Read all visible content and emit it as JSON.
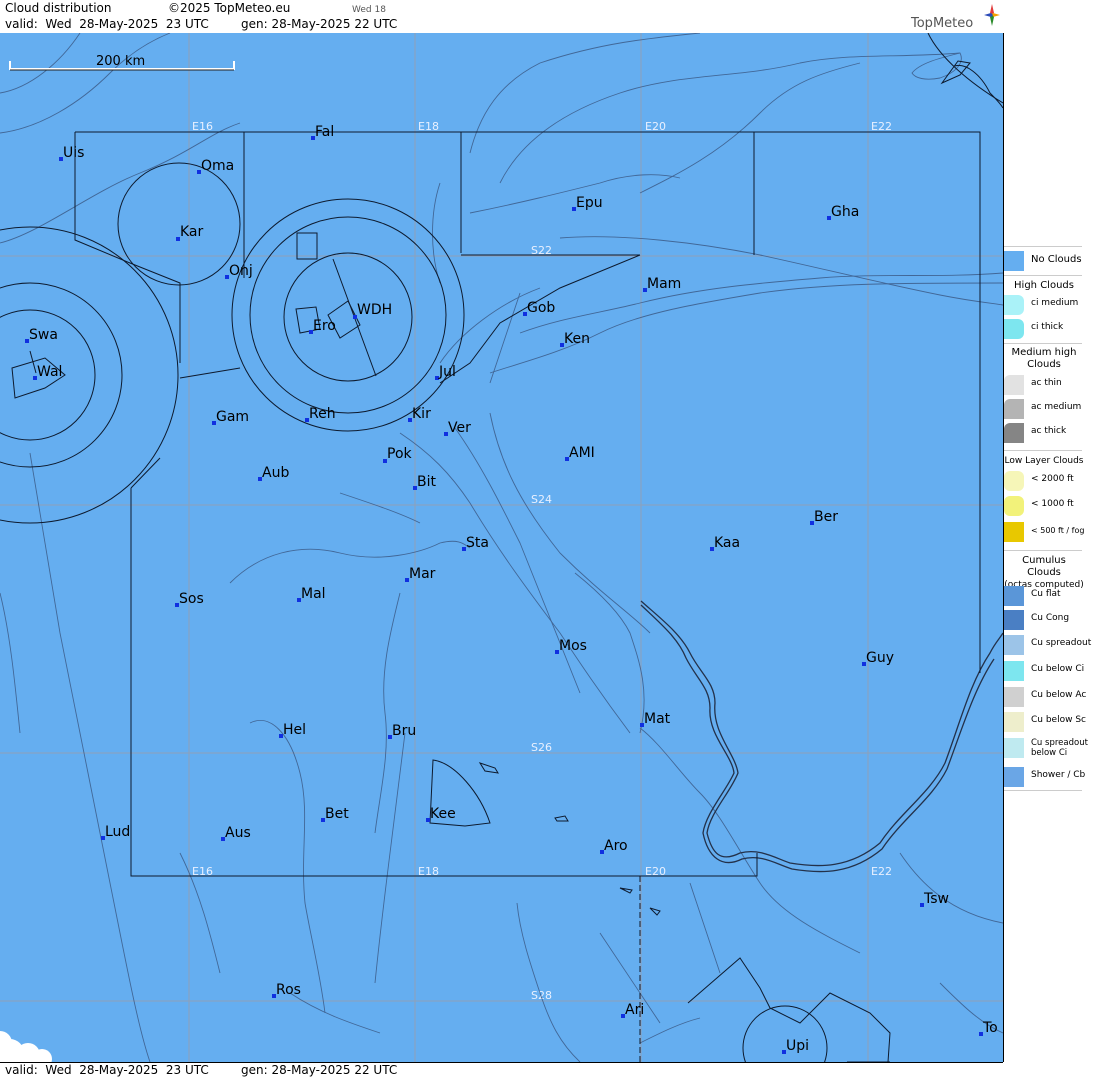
{
  "header": {
    "title": "Cloud distribution",
    "copyright": "©2025 TopMeteo.eu",
    "day_tag": "Wed 18",
    "valid": "valid:  Wed  28-May-2025  23 UTC",
    "gen": "gen: 28-May-2025 22 UTC",
    "logo": "TopMeteo"
  },
  "footer": {
    "valid": "valid:  Wed  28-May-2025  23 UTC",
    "gen": "gen: 28-May-2025 22 UTC"
  },
  "scale_bar": {
    "label": "200 km"
  },
  "grid_labels": {
    "lon": [
      "E16",
      "E18",
      "E20",
      "E22"
    ],
    "lat": [
      "S22",
      "S24",
      "S26",
      "S28"
    ]
  },
  "places": [
    {
      "name": "Uis"
    },
    {
      "name": "Fal"
    },
    {
      "name": "Oma"
    },
    {
      "name": "Kar"
    },
    {
      "name": "Epu"
    },
    {
      "name": "Gha"
    },
    {
      "name": "Onj"
    },
    {
      "name": "Mam"
    },
    {
      "name": "Swa"
    },
    {
      "name": "Wal"
    },
    {
      "name": "Ero"
    },
    {
      "name": "WDH"
    },
    {
      "name": "Gob"
    },
    {
      "name": "Ken"
    },
    {
      "name": "Jul"
    },
    {
      "name": "Gam"
    },
    {
      "name": "Reh"
    },
    {
      "name": "Kir"
    },
    {
      "name": "Ver"
    },
    {
      "name": "Pok"
    },
    {
      "name": "AMI"
    },
    {
      "name": "Aub"
    },
    {
      "name": "Bit"
    },
    {
      "name": "Ber"
    },
    {
      "name": "Sta"
    },
    {
      "name": "Kaa"
    },
    {
      "name": "Mar"
    },
    {
      "name": "Sos"
    },
    {
      "name": "Mal"
    },
    {
      "name": "Mos"
    },
    {
      "name": "Guy"
    },
    {
      "name": "Mat"
    },
    {
      "name": "Hel"
    },
    {
      "name": "Bru"
    },
    {
      "name": "Bet"
    },
    {
      "name": "Kee"
    },
    {
      "name": "Lud"
    },
    {
      "name": "Aus"
    },
    {
      "name": "Aro"
    },
    {
      "name": "Tsw"
    },
    {
      "name": "Ros"
    },
    {
      "name": "Ari"
    },
    {
      "name": "Upi"
    },
    {
      "name": "To"
    }
  ],
  "legend": {
    "no_clouds": {
      "label": "No Clouds",
      "color": "#65aef0"
    },
    "high_heading": "High Clouds",
    "high": [
      {
        "label": "ci medium",
        "color": "#aaf2f8"
      },
      {
        "label": "ci thick",
        "color": "#7de6ef"
      }
    ],
    "medium_heading": [
      "Medium high",
      "Clouds"
    ],
    "medium": [
      {
        "label": "ac thin",
        "color": "#e2e2e2"
      },
      {
        "label": "ac medium",
        "color": "#b4b4b4"
      },
      {
        "label": "ac thick",
        "color": "#858585"
      }
    ],
    "low_heading": "Low Layer Clouds",
    "low": [
      {
        "label": "< 2000 ft",
        "color": "#f6f6b8"
      },
      {
        "label": "< 1000 ft",
        "color": "#f2f27a"
      },
      {
        "label": "< 500 ft / fog",
        "color": "#e8c800"
      }
    ],
    "cumulus_heading": [
      "Cumulus Clouds",
      "(octas computed)"
    ],
    "cumulus": [
      {
        "label": "Cu flat",
        "color": "#5a96d8"
      },
      {
        "label": "Cu Cong",
        "color": "#4a7fc4"
      },
      {
        "label": "Cu spreadout",
        "color": "#9cc4e8"
      },
      {
        "label": "Cu below Ci",
        "color": "#7de6ef"
      },
      {
        "label": "Cu below Ac",
        "color": "#d0d0d0"
      },
      {
        "label": "Cu below Sc",
        "color": "#eeeecc"
      },
      {
        "label": "Cu spreadout below Ci",
        "color": "#bfeaf0"
      },
      {
        "label": "Shower / Cb",
        "color": "#6aa6e6"
      }
    ]
  }
}
